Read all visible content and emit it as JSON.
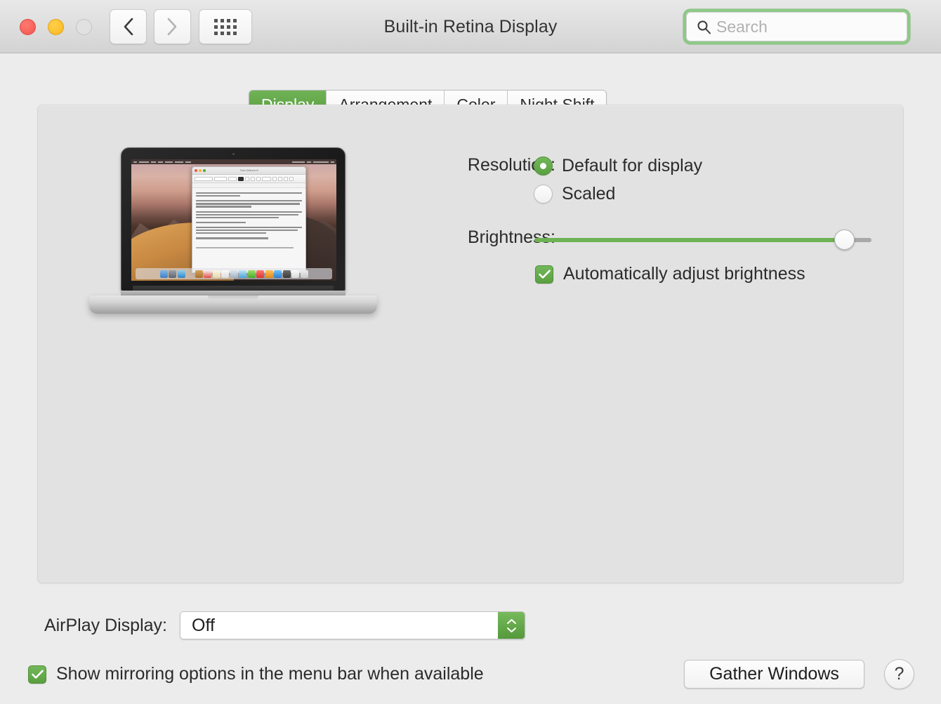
{
  "window": {
    "title": "Built-in Retina Display",
    "traffic_lights": [
      {
        "name": "close",
        "color": "#f2544c"
      },
      {
        "name": "minimize",
        "color": "#f8b723"
      },
      {
        "name": "zoom",
        "color": "#e1e1e1"
      }
    ],
    "nav": {
      "back_icon": "chevron-left-icon",
      "forward_icon": "chevron-right-icon",
      "grid_icon": "grid-icon"
    },
    "search": {
      "placeholder": "Search",
      "value": "",
      "icon": "search-icon",
      "highlight_color": "#8ec987"
    }
  },
  "tabs": [
    {
      "label": "Display",
      "active": true
    },
    {
      "label": "Arrangement",
      "active": false
    },
    {
      "label": "Color",
      "active": false
    },
    {
      "label": "Night Shift",
      "active": false
    }
  ],
  "display_preview": {
    "device": "MacBook Pro",
    "wallpaper": "Mojave Desert",
    "window_title": "Think Different.rtf",
    "paragraphs": [
      "Here's to the crazy ones. The misfits. The rebels. The troublemakers. The round pegs in the square holes.",
      "The ones who see things differently. They're not fond of rules. And they have no respect for the status quo. You can quote them, disagree with them, glorify or vilify them.",
      "But the only thing you can't do is ignore them. Because they change things. They invent. They imagine. They heal. They explore. They create. They inspire. They push the human race forward.",
      "Maybe they have to be crazy.",
      "How else can you stare at an empty canvas and see a work of art? Or sit in silence and hear a song that's never been written? Or gaze at a red planet and see a laboratory on wheels?",
      "We make tools for these kinds of people."
    ]
  },
  "resolution": {
    "label": "Resolution:",
    "options": [
      {
        "label": "Default for display",
        "selected": true
      },
      {
        "label": "Scaled",
        "selected": false
      }
    ]
  },
  "brightness": {
    "label": "Brightness:",
    "value_percent": 92,
    "auto_adjust": {
      "label": "Automatically adjust brightness",
      "checked": true
    }
  },
  "airplay": {
    "label": "AirPlay Display:",
    "value": "Off",
    "options": [
      "Off"
    ]
  },
  "mirroring": {
    "label": "Show mirroring options in the menu bar when available",
    "checked": true
  },
  "footer": {
    "gather_windows_label": "Gather Windows",
    "help_label": "?"
  },
  "colors": {
    "accent_green": "#5aa03f",
    "tab_active_green": "#6fb356",
    "highlight_green": "#8ec987",
    "window_bg": "#ececec",
    "content_bg": "#e2e2e2"
  }
}
